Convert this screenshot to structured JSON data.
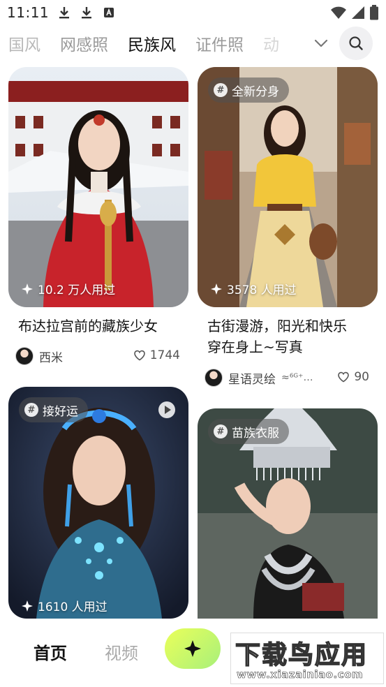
{
  "status_bar": {
    "time": "11:11",
    "left_icons": [
      "download-icon",
      "download-icon",
      "font-a-icon"
    ],
    "right_icons": [
      "wifi-icon",
      "signal-icon",
      "battery-icon"
    ]
  },
  "category_tabs": {
    "items": [
      {
        "label": "国风",
        "state": "partial"
      },
      {
        "label": "网感照",
        "state": "inactive"
      },
      {
        "label": "民族风",
        "state": "active"
      },
      {
        "label": "证件照",
        "state": "inactive"
      },
      {
        "label": "动",
        "state": "faded"
      }
    ],
    "expand_icon": "chevron-down-icon",
    "search_icon": "search-icon",
    "accent_color": "#c9f36b"
  },
  "cards": [
    {
      "tag": "",
      "usage": "10.2 万人用过",
      "title": "布达拉宫前的藏族少女",
      "author": "西米",
      "likes": "1744"
    },
    {
      "tag": "全新分身",
      "usage": "3578 人用过",
      "title_line1": "古街漫游，阳光和快乐",
      "title_line2": "穿在身上~写真",
      "author": "星语灵绘",
      "author_suffix": "≈⁶ᴳ⁺…",
      "likes": "90"
    },
    {
      "tag": "接好运",
      "usage": "1610 人用过",
      "has_video_badge": true
    },
    {
      "tag": "苗族衣服"
    }
  ],
  "bottom_nav": {
    "home": "首页",
    "video": "视频",
    "create_icon": "sparkle-icon",
    "create_color": "#d7f85f"
  },
  "watermark": {
    "main": "下载鸟应用",
    "url": "www.xiazainiao.com"
  }
}
